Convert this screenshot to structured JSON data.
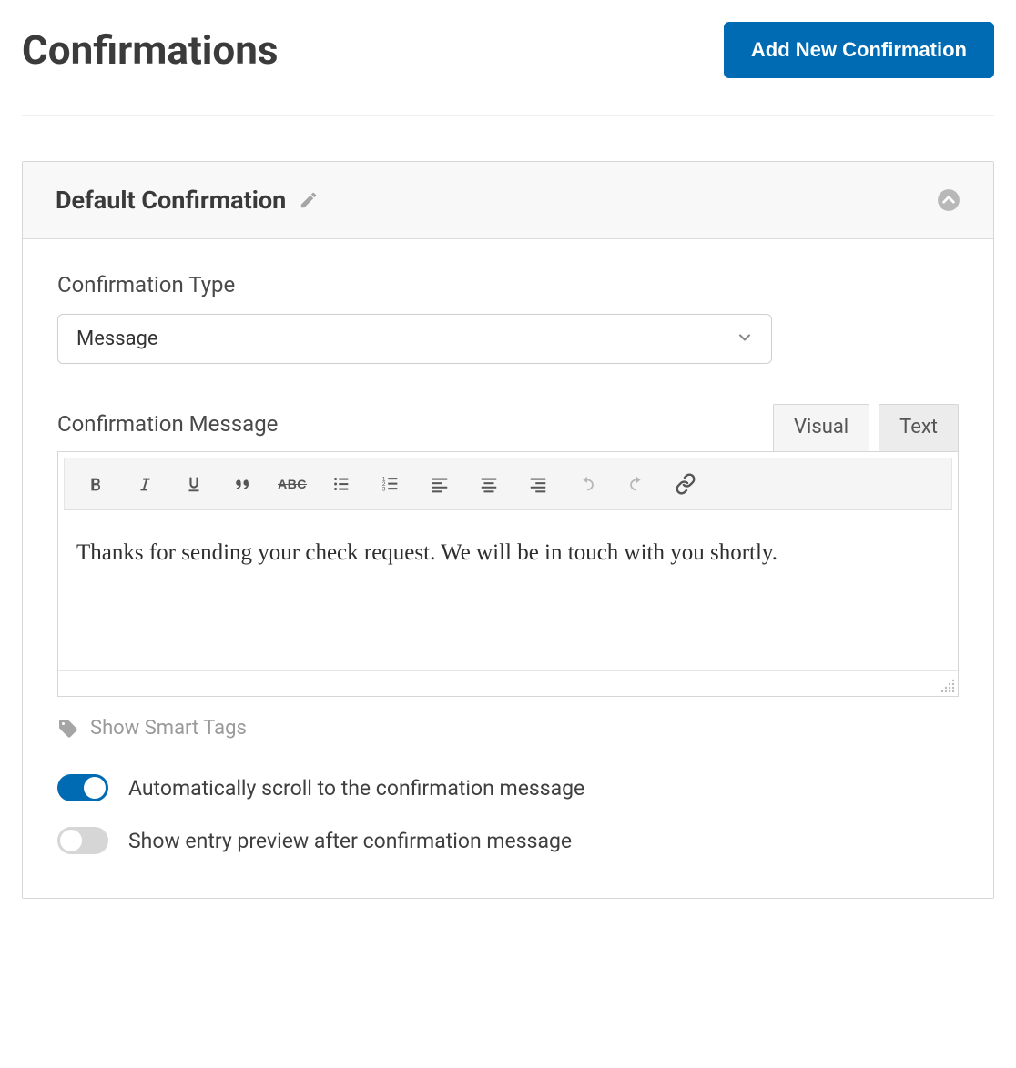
{
  "header": {
    "title": "Confirmations",
    "add_button": "Add New Confirmation"
  },
  "panel": {
    "title": "Default Confirmation"
  },
  "fields": {
    "type_label": "Confirmation Type",
    "type_value": "Message",
    "message_label": "Confirmation Message",
    "message_content": "Thanks for sending your check request. We will be in touch with you shortly."
  },
  "tabs": {
    "visual": "Visual",
    "text": "Text"
  },
  "smart_tags": {
    "label": "Show Smart Tags"
  },
  "toggles": {
    "auto_scroll": {
      "label": "Automatically scroll to the confirmation message",
      "on": true
    },
    "entry_preview": {
      "label": "Show entry preview after confirmation message",
      "on": false
    }
  }
}
